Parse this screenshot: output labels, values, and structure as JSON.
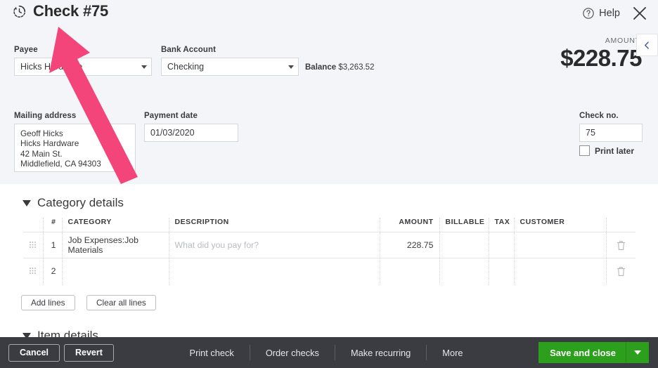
{
  "header": {
    "title": "Check #75",
    "history_icon": "clock-history-icon",
    "help_label": "Help",
    "help_icon": "question-circle-icon",
    "close_icon": "close-x-icon",
    "collapse_icon": "chevron-left-icon"
  },
  "amount": {
    "label": "AMOUNT",
    "value": "$228.75"
  },
  "form": {
    "payee": {
      "label": "Payee",
      "value": "Hicks Hardware"
    },
    "bank_account": {
      "label": "Bank Account",
      "value": "Checking"
    },
    "balance": {
      "label": "Balance",
      "value": "$3,263.52"
    },
    "mailing_address": {
      "label": "Mailing address",
      "value": "Geoff Hicks\nHicks Hardware\n42 Main St.\nMiddlefield, CA  94303"
    },
    "payment_date": {
      "label": "Payment date",
      "value": "01/03/2020"
    },
    "check_no": {
      "label": "Check no.",
      "value": "75"
    },
    "print_later": {
      "label": "Print later",
      "checked": false
    }
  },
  "category_details": {
    "section_title": "Category details",
    "columns": [
      "#",
      "CATEGORY",
      "DESCRIPTION",
      "AMOUNT",
      "BILLABLE",
      "TAX",
      "CUSTOMER"
    ],
    "rows": [
      {
        "num": "1",
        "category": "Job Expenses:Job Materials",
        "description": "",
        "description_placeholder": "What did you pay for?",
        "amount": "228.75",
        "billable": "",
        "tax": "",
        "customer": "",
        "delete_icon": "trash-icon",
        "drag_icon": "drag-handle-icon"
      },
      {
        "num": "2",
        "category": "",
        "description": "",
        "description_placeholder": "",
        "amount": "",
        "billable": "",
        "tax": "",
        "customer": "",
        "delete_icon": "trash-icon",
        "drag_icon": "drag-handle-icon"
      }
    ],
    "add_lines_label": "Add lines",
    "clear_all_lines_label": "Clear all lines"
  },
  "item_details": {
    "section_title": "Item details"
  },
  "footer": {
    "cancel_label": "Cancel",
    "revert_label": "Revert",
    "print_check_label": "Print check",
    "order_checks_label": "Order checks",
    "make_recurring_label": "Make recurring",
    "more_label": "More",
    "save_and_close_label": "Save and close",
    "save_dropdown_icon": "caret-down-icon"
  },
  "annotation": {
    "arrow_color": "#F4457B",
    "arrow_name": "pink-annotation-arrow"
  }
}
